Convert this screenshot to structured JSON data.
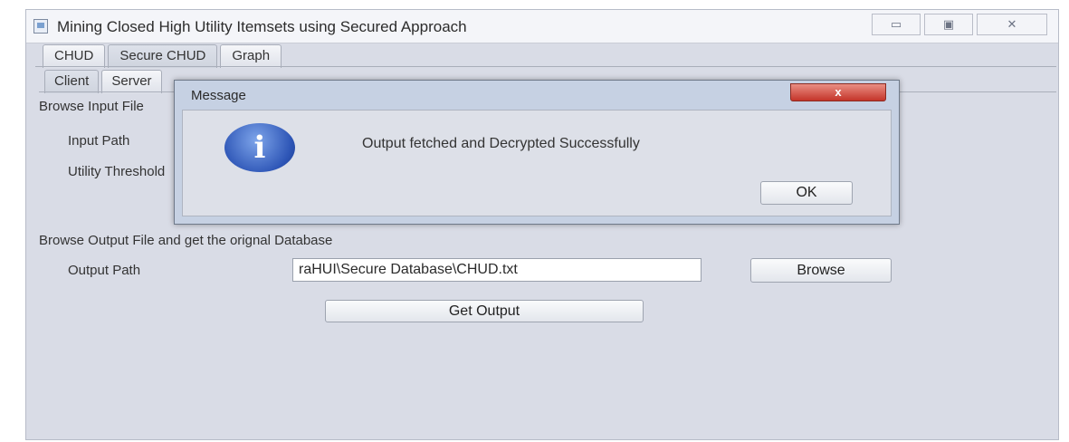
{
  "window": {
    "title": "Mining Closed High Utility Itemsets using Secured Approach",
    "controls": {
      "minimize": "▭",
      "maximize": "▣",
      "close": "✕"
    }
  },
  "tabs": {
    "outer": [
      "CHUD",
      "Secure CHUD",
      "Graph"
    ],
    "inner": [
      "Client",
      "Server"
    ]
  },
  "client": {
    "input_section": "Browse Input File",
    "input_path_label": "Input Path",
    "utility_label": "Utility Threshold",
    "output_section": "Browse Output File and get the orignal Database",
    "output_path_label": "Output Path",
    "output_path_value": "raHUI\\Secure Database\\CHUD.txt",
    "browse_label": "Browse",
    "get_output_label": "Get Output"
  },
  "dialog": {
    "title": "Message",
    "close": "x",
    "icon": "info-icon",
    "icon_glyph": "i",
    "message": "Output fetched and Decrypted Successfully",
    "ok_label": "OK"
  }
}
